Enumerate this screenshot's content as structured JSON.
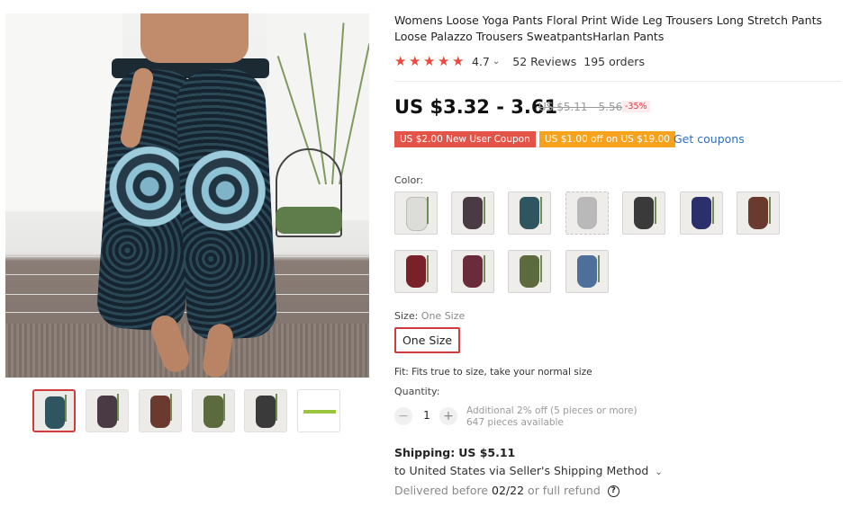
{
  "product": {
    "title": "Womens Loose Yoga Pants Floral Print Wide Leg Trousers Long Stretch Pants Loose Palazzo Trousers SweatpantsHarlan Pants",
    "rating": "4.7",
    "rating_stars": 5,
    "reviews": "52 Reviews",
    "orders": "195 orders"
  },
  "price": {
    "current": "US $3.32 - 3.61",
    "original": "US $5.11 - 5.56",
    "discount": "-35%"
  },
  "coupons": {
    "new_user": "US $2.00 New User Coupon",
    "threshold": "US $1.00 off on US $19.00",
    "get_link": "Get coupons"
  },
  "color": {
    "label": "Color:",
    "swatches": [
      {
        "name": "white",
        "color": "#dcdcd8"
      },
      {
        "name": "black-pink",
        "color": "#4a3a44"
      },
      {
        "name": "teal-floral",
        "color": "#2f5560"
      },
      {
        "name": "grey-light",
        "color": "#b9b9b9"
      },
      {
        "name": "dark-print",
        "color": "#3a3a3a"
      },
      {
        "name": "navy-blue",
        "color": "#2b2f6b"
      },
      {
        "name": "brown",
        "color": "#6a3a2e"
      },
      {
        "name": "maroon",
        "color": "#7a2028"
      },
      {
        "name": "wine-print",
        "color": "#6a2b3a"
      },
      {
        "name": "olive-green",
        "color": "#5c6a3e"
      },
      {
        "name": "blue-white",
        "color": "#4e6f9a"
      }
    ]
  },
  "size": {
    "label": "Size:",
    "selected": "One Size",
    "option": "One Size"
  },
  "fit": "Fit: Fits true to size, take your normal size",
  "quantity": {
    "label": "Quantity:",
    "value": "1",
    "minus": "−",
    "plus": "+",
    "note_discount": "Additional 2% off (5 pieces or more)",
    "note_available": "647 pieces available"
  },
  "shipping": {
    "label": "Shipping:",
    "cost": "US $5.11",
    "method": "to United States via Seller's Shipping Method",
    "delivered_prefix": "Delivered before",
    "delivered_date": "02/22",
    "delivered_suffix": "or full refund"
  },
  "gallery": {
    "thumbs": [
      {
        "color": "#2f5560",
        "active": true
      },
      {
        "color": "#4a3a44",
        "active": false
      },
      {
        "color": "#6a3a2e",
        "active": false
      },
      {
        "color": "#5c6a3e",
        "active": false
      },
      {
        "color": "#3a3a3a",
        "active": false
      },
      {
        "color": "#9bc53d",
        "active": false
      }
    ]
  },
  "colors": {
    "accent_red": "#e84a3f",
    "link_blue": "#2e6ec2",
    "coupon_orange": "#f6a21c"
  }
}
